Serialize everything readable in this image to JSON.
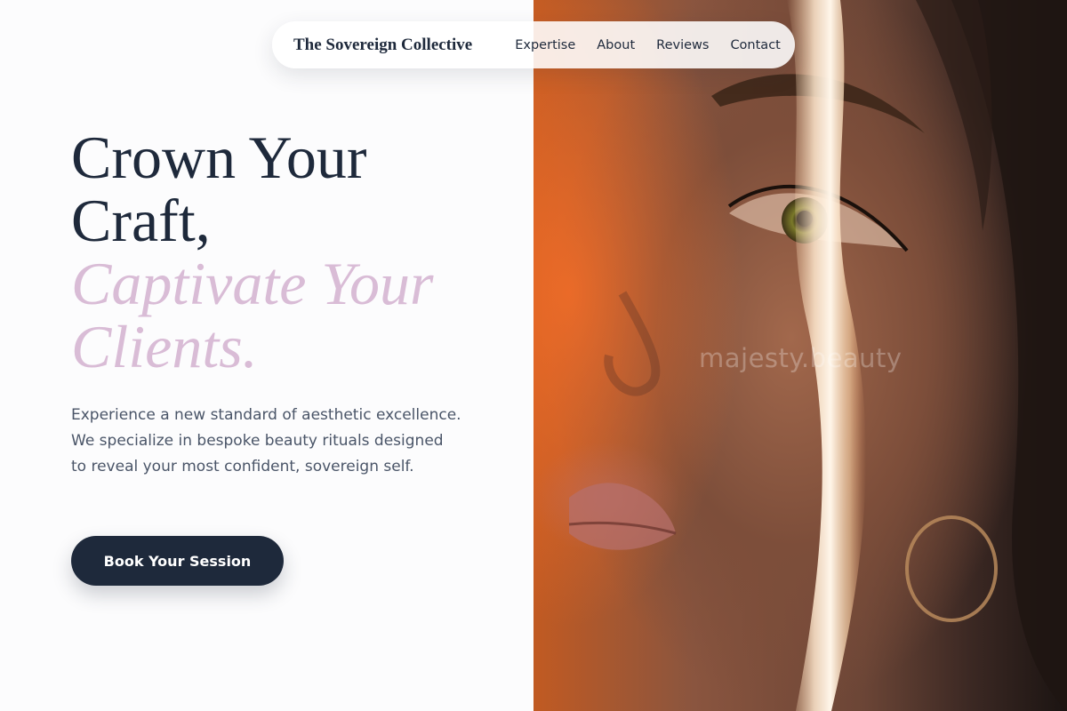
{
  "nav": {
    "brand": "The Sovereign Collective",
    "links": [
      {
        "label": "Expertise"
      },
      {
        "label": "About"
      },
      {
        "label": "Reviews"
      },
      {
        "label": "Contact"
      }
    ]
  },
  "hero": {
    "headline_line1": "Crown Your",
    "headline_line2": "Craft,",
    "headline_accent_line1": "Captivate Your",
    "headline_accent_line2": "Clients.",
    "intro": "Experience a new standard of aesthetic excellence. We specialize in bespoke beauty rituals designed to reveal your most confident, sovereign self.",
    "cta_label": "Book Your Session",
    "photo_watermark": "majesty.beauty"
  },
  "colors": {
    "primary": "#1e293b",
    "accent": "#d9bcd6",
    "body_text": "#4a5568",
    "background": "#fcfcfd"
  }
}
